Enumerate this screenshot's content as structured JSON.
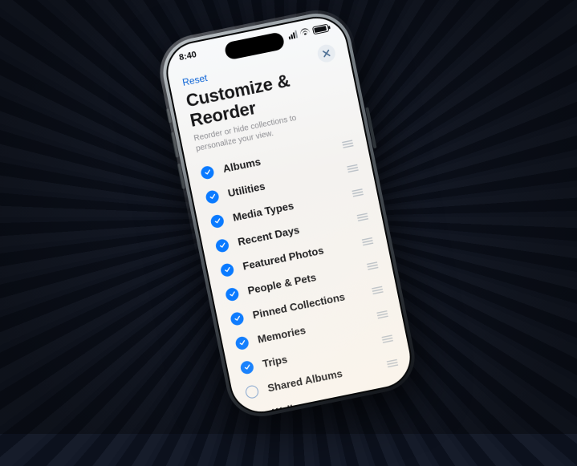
{
  "status": {
    "time": "8:40"
  },
  "nav": {
    "reset_label": "Reset"
  },
  "sheet": {
    "title": "Customize & Reorder",
    "subtitle": "Reorder or hide collections to personalize your view."
  },
  "options": [
    {
      "label": "Albums",
      "checked": true
    },
    {
      "label": "Utilities",
      "checked": true
    },
    {
      "label": "Media Types",
      "checked": true
    },
    {
      "label": "Recent Days",
      "checked": true
    },
    {
      "label": "Featured Photos",
      "checked": true
    },
    {
      "label": "People & Pets",
      "checked": true
    },
    {
      "label": "Pinned Collections",
      "checked": true
    },
    {
      "label": "Memories",
      "checked": true
    },
    {
      "label": "Trips",
      "checked": true
    },
    {
      "label": "Shared Albums",
      "checked": false
    },
    {
      "label": "Wallpaper Suggestions",
      "checked": false
    }
  ]
}
